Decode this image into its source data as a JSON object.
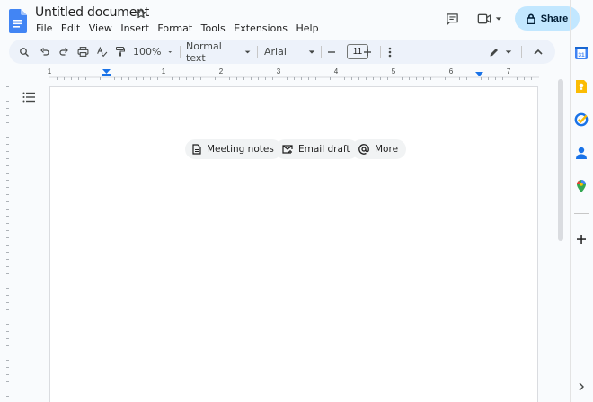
{
  "doc": {
    "title": "Untitled document"
  },
  "menu": [
    "File",
    "Edit",
    "View",
    "Insert",
    "Format",
    "Tools",
    "Extensions",
    "Help"
  ],
  "header": {
    "share_label": "Share"
  },
  "toolbar": {
    "zoom": "100%",
    "style": "Normal text",
    "font": "Arial",
    "font_size": "11"
  },
  "ruler": {
    "labels": [
      "1",
      "1",
      "2",
      "3",
      "4",
      "5",
      "6",
      "7"
    ]
  },
  "chips": [
    {
      "label": "Meeting notes",
      "icon": "doc-icon"
    },
    {
      "label": "Email draft",
      "icon": "mail-icon"
    },
    {
      "label": "More",
      "icon": "at-icon"
    }
  ],
  "side_panel": {
    "icons": [
      "calendar-icon",
      "keep-icon",
      "tasks-icon",
      "contacts-icon",
      "maps-icon",
      "add-icon"
    ]
  },
  "colors": {
    "accent": "#1a73e8",
    "share_bg": "#c2e7ff",
    "toolbar_bg": "#edf2fa"
  }
}
